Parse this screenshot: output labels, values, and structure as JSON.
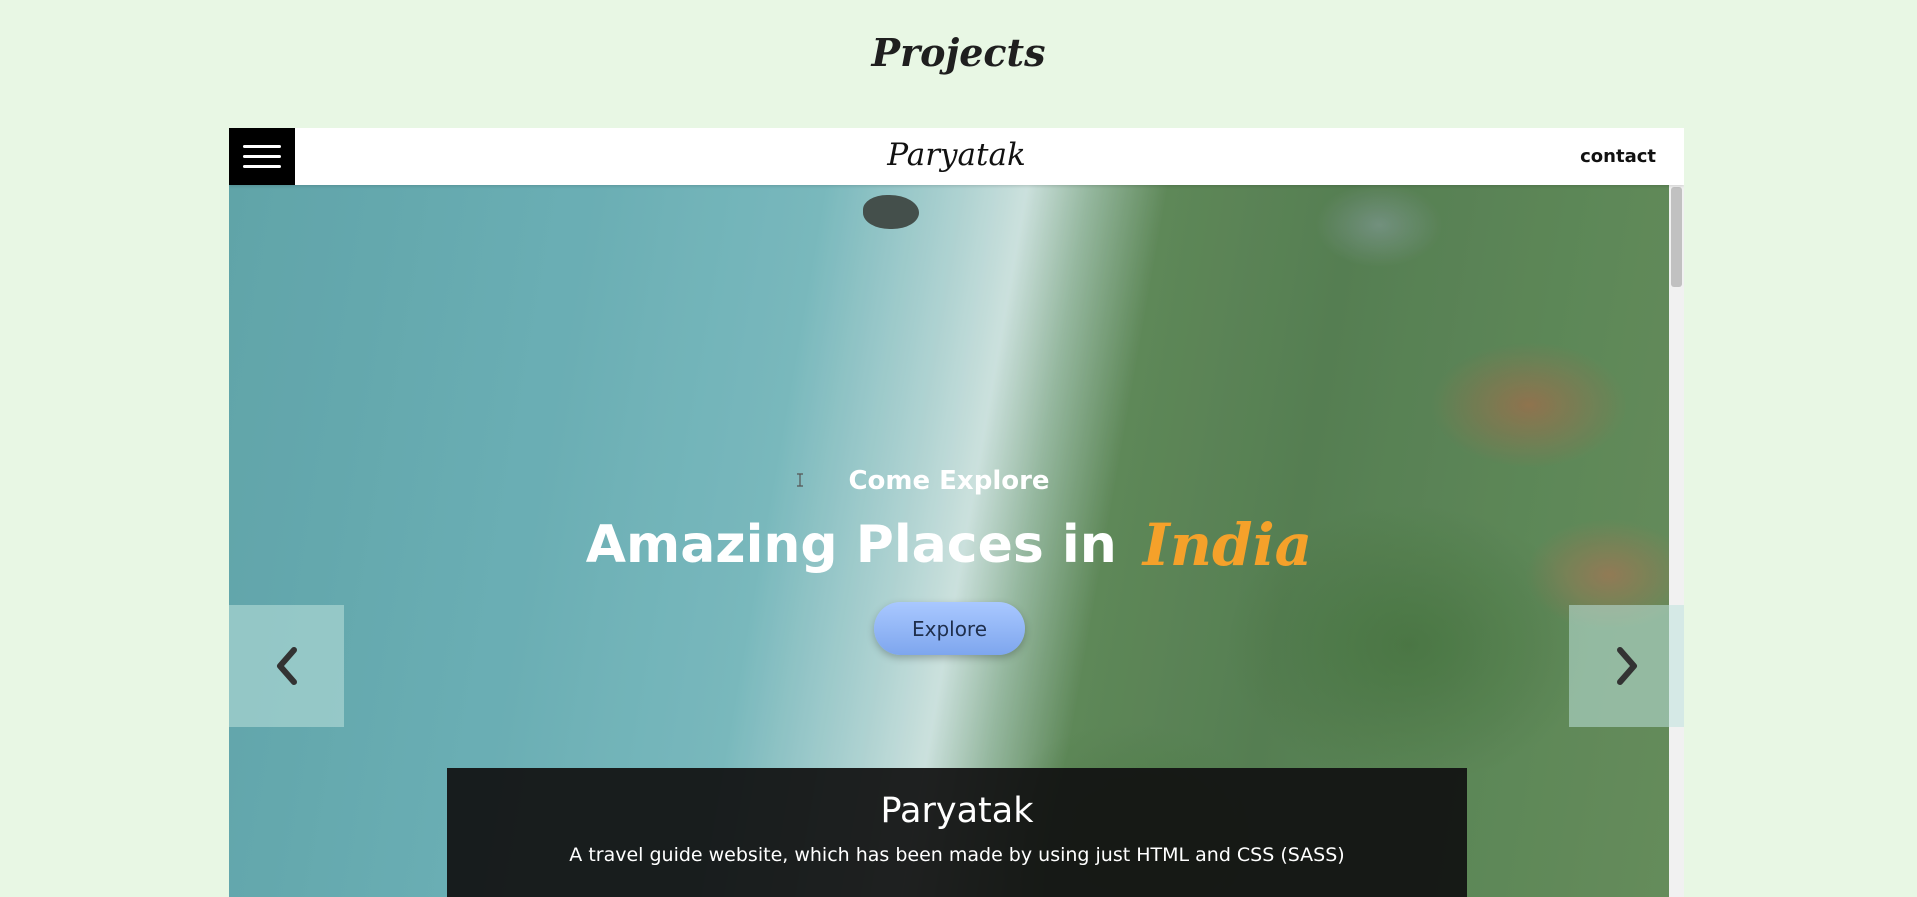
{
  "page": {
    "title": "Projects"
  },
  "project": {
    "navbar": {
      "brand": "Paryatak",
      "contact_label": "contact",
      "menu_icon": "hamburger-icon"
    },
    "hero": {
      "kicker": "Come Explore",
      "headline": "Amazing Places in",
      "headline_accent": "India",
      "cta_label": "Explore"
    },
    "carousel": {
      "prev_icon": "chevron-left-icon",
      "next_icon": "chevron-right-icon"
    },
    "caption": {
      "title": "Paryatak",
      "description": "A travel guide website, which has been made by using just HTML and CSS (SASS)"
    }
  },
  "colors": {
    "page_background": "#e8f7e4",
    "accent": "#f5a12a",
    "cta": "#8fb3f5",
    "caption_background": "#111111"
  }
}
